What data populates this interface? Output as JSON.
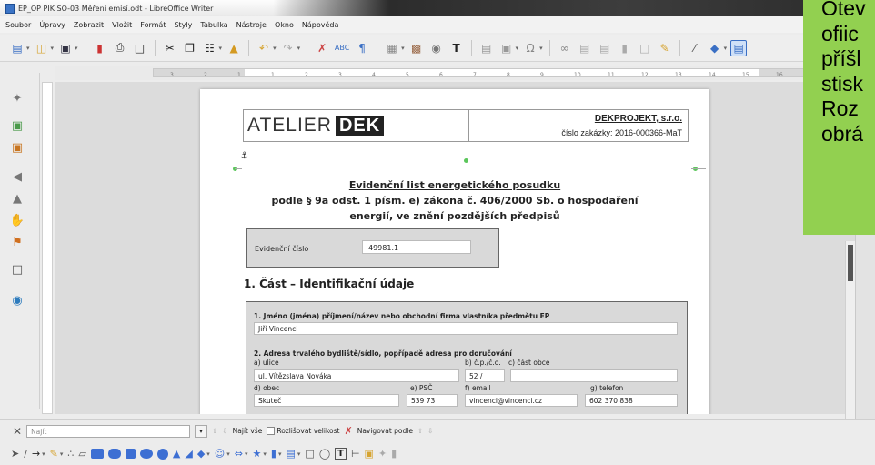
{
  "window": {
    "title": "EP_OP PIK SO-03 Měření emisí.odt - LibreOffice Writer"
  },
  "menu": [
    "Soubor",
    "Úpravy",
    "Zobrazit",
    "Vložit",
    "Formát",
    "Styly",
    "Tabulka",
    "Nástroje",
    "Okno",
    "Nápověda"
  ],
  "toolbar_icons": [
    "new-icon",
    "open-icon",
    "save-icon",
    "export-pdf-icon",
    "print-icon",
    "print-preview-icon",
    "cut-icon",
    "copy-icon",
    "paste-icon",
    "clone-formatting-icon",
    "undo-icon",
    "redo-icon",
    "find-replace-icon",
    "spelling-icon",
    "formatting-marks-icon",
    "table-icon",
    "image-icon",
    "chart-icon",
    "text-box-icon",
    "page-break-icon",
    "field-icon",
    "special-character-icon",
    "hyperlink-icon",
    "footnote-icon",
    "endnote-icon",
    "bookmark-icon",
    "cross-reference-icon",
    "comment-icon",
    "track-changes-icon",
    "line-icon",
    "shapes-icon",
    "draw-functions-icon"
  ],
  "ruler": {
    "ticks": [
      "3",
      "2",
      "1",
      "1",
      "2",
      "3",
      "4",
      "5",
      "6",
      "7",
      "8",
      "9",
      "10",
      "11",
      "12",
      "13",
      "14",
      "15",
      "16",
      "17"
    ]
  },
  "document": {
    "logo_text": "ATELIER",
    "logo_bold": "DEK",
    "company": "DEKPROJEKT, s.r.o.",
    "order_number": "číslo zakázky: 2016-000366-MaT",
    "title_line1": "Evidenční list energetického posudku",
    "title_line2": "podle § 9a odst. 1 písm. e) zákona č. 406/2000 Sb. o hospodaření",
    "title_line3": "energií, ve znění pozdějších předpisů",
    "evid_label": "Evidenční číslo",
    "evid_value": "49981.1",
    "section1": "1. Část – Identifikační údaje",
    "q1": "1. Jméno (jména) příjmení/název nebo obchodní firma vlastníka předmětu EP",
    "q1_value": "Jiří Vincenci",
    "q2": "2. Adresa trvalého bydliště/sídlo, popřípadě adresa pro doručování",
    "a_label": "a) ulice",
    "b_label": "b) č.p./č.o.",
    "c_label": "c) část obce",
    "a_value": "ul. Vítězslava Nováka",
    "b_value": "52 /",
    "d_label": "d) obec",
    "e_label": "e) PSČ",
    "f_label": "f) email",
    "g_label": "g) telefon",
    "d_value": "Skuteč",
    "e_value": "539 73",
    "f_value": "vincenci@vincenci.cz",
    "g_value": "602 370 838"
  },
  "overlay_text": [
    "Otev",
    "ofiic",
    "příšl",
    "stisk",
    "Roz",
    "obrá"
  ],
  "findbar": {
    "placeholder": "Najít",
    "find_all": "Najít vše",
    "match_case": "Rozlišovat velikost",
    "navigate_by": "Navigovat podle"
  },
  "draw_icons": [
    "select-icon",
    "line-icon",
    "arrow-icon",
    "freeform-icon",
    "curve-icon",
    "polygon-icon",
    "rectangle-icon",
    "ellipse-icon",
    "triangle-icon",
    "basic-shapes-icon",
    "symbol-shapes-icon",
    "block-arrows-icon",
    "stars-icon",
    "callouts-icon",
    "flowchart-icon",
    "text-icon",
    "align-icon",
    "wrap-icon",
    "group-icon",
    "points-icon",
    "fontwork-icon"
  ],
  "colors": {
    "accent_green": "#92d050",
    "toolbar_blue": "#3d6fd3"
  }
}
